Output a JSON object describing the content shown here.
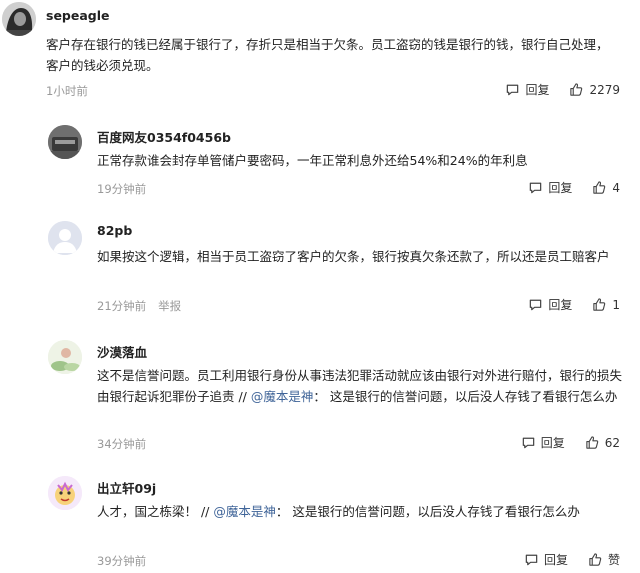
{
  "comments": [
    {
      "user": "sepeagle",
      "avatar_icon": "avatar-bw-photo-icon",
      "text": "客户存在银行的钱已经属于银行了，存折只是相当于欠条。员工盗窃的钱是银行的钱，银行自己处理，客户的钱必须兑现。",
      "time": "1小时前",
      "reply_label": "回复",
      "likes": "2279"
    },
    {
      "user": "百度网友0354f0456b",
      "avatar_icon": "avatar-photo-icon",
      "text": "正常存款谁会封存单管储户要密码，一年正常利息外还给54%和24%的年利息",
      "time": "19分钟前",
      "reply_label": "回复",
      "likes": "4"
    },
    {
      "user": "82pb",
      "avatar_icon": "default-avatar-icon",
      "text": "如果按这个逻辑，相当于员工盗窃了客户的欠条，银行按真欠条还款了，所以还是员工赔客户",
      "time": "21分钟前",
      "report_label": "举报",
      "reply_label": "回复",
      "likes": "1"
    },
    {
      "user": "沙漠落血",
      "avatar_icon": "avatar-illustration-icon",
      "text": "这不是信誉问题。员工利用银行身份从事违法犯罪活动就应该由银行对外进行赔付，银行的损失由银行起诉犯罪份子追责 // ",
      "mention": "@魔本是神",
      "text_after": "： 这是银行的信誉问题，以后没人存钱了看银行怎么办",
      "time": "34分钟前",
      "reply_label": "回复",
      "likes": "62"
    },
    {
      "user": "出立轩09j",
      "avatar_icon": "avatar-cartoon-icon",
      "text": "人才，国之栋梁！ // ",
      "mention": "@魔本是神",
      "text_after": "： 这是银行的信誉问题，以后没人存钱了看银行怎么办",
      "time": "39分钟前",
      "reply_label": "回复",
      "likes": "赞"
    }
  ],
  "colors": {
    "mention": "#406599",
    "meta": "#999999"
  }
}
